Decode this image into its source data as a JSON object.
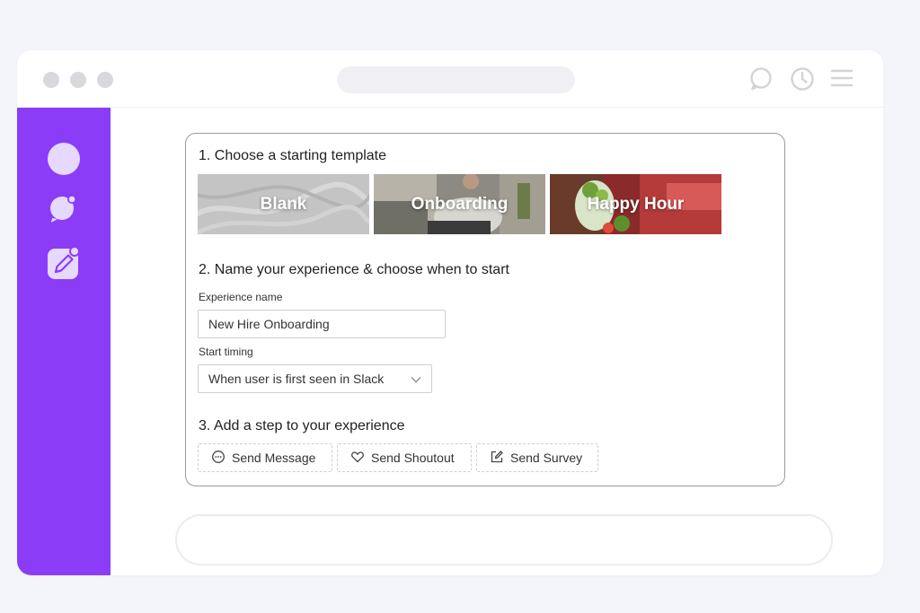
{
  "colors": {
    "background": "#f3f5fb",
    "sidebar": "#8b3cf7",
    "sidebar_icon": "#e6d9ff",
    "window_chrome": "#d9d9dd"
  },
  "titlebar": {
    "icons": [
      "chat-icon",
      "clock-icon",
      "menu-icon"
    ]
  },
  "sidebar": {
    "items": [
      {
        "icon": "avatar-icon"
      },
      {
        "icon": "chat-notification-icon"
      },
      {
        "icon": "edit-notification-icon"
      }
    ]
  },
  "form": {
    "section1_title": "1. Choose a starting template",
    "templates": [
      {
        "label": "Blank"
      },
      {
        "label": "Onboarding"
      },
      {
        "label": "Happy Hour"
      }
    ],
    "section2_title": "2. Name your experience & choose when to start",
    "name_label": "Experience name",
    "name_value": "New Hire Onboarding",
    "timing_label": "Start timing",
    "timing_value": "When user is first seen in Slack",
    "section3_title": "3. Add a step to your experience",
    "steps": [
      {
        "label": "Send Message",
        "icon": "message-icon"
      },
      {
        "label": "Send Shoutout",
        "icon": "heart-icon"
      },
      {
        "label": "Send Survey",
        "icon": "edit-icon"
      }
    ]
  }
}
